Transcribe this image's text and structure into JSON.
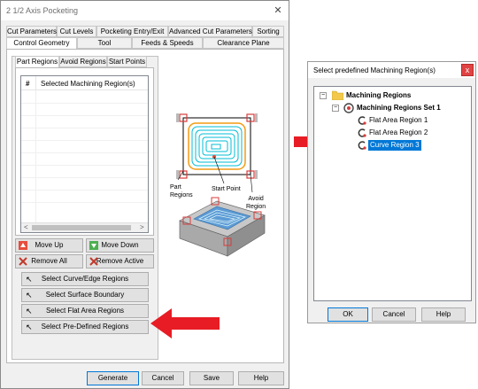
{
  "main_window": {
    "title": "2 1/2 Axis Pocketing",
    "tabs_row1": [
      "Cut Parameters",
      "Cut Levels",
      "Pocketing Entry/Exit",
      "Advanced Cut Parameters",
      "Sorting"
    ],
    "tabs_row2": [
      "Control Geometry",
      "Tool",
      "Feeds & Speeds",
      "Clearance Plane"
    ],
    "selected_tab": "Control Geometry",
    "sub_tabs": [
      "Part Regions",
      "Avoid Regions",
      "Start Points"
    ],
    "list": {
      "col_hash": "#",
      "col_name": "Selected Machining Region(s)"
    },
    "buttons": {
      "move_up": "Move Up",
      "move_down": "Move Down",
      "remove_all": "Remove All",
      "remove_active": "Remove Active",
      "select_curve": "Select Curve/Edge Regions",
      "select_surface": "Select Surface Boundary",
      "select_flat": "Select Flat Area Regions",
      "select_predefined": "Select Pre-Defined Regions"
    },
    "illustration": {
      "label_part": "Part\nRegions",
      "label_start": "Start Point",
      "label_avoid": "Avoid\nRegion"
    },
    "footer": {
      "generate": "Generate",
      "cancel": "Cancel",
      "save": "Save",
      "help": "Help"
    }
  },
  "dialog": {
    "title": "Select predefined Machining Region(s)",
    "tree": {
      "root": "Machining Regions",
      "set": "Machining Regions Set 1",
      "items": [
        "Flat Area Region 1",
        "Flat Area Region 2",
        "Curve Region 3"
      ],
      "selected_item": "Curve Region 3"
    },
    "buttons": {
      "ok": "OK",
      "cancel": "Cancel",
      "help": "Help"
    }
  },
  "colors": {
    "arrow": "#e81c24",
    "selection": "#0078d7",
    "toolpath": "#00bcd4",
    "region_red": "#d83b3b",
    "folder": "#f2c94c"
  }
}
